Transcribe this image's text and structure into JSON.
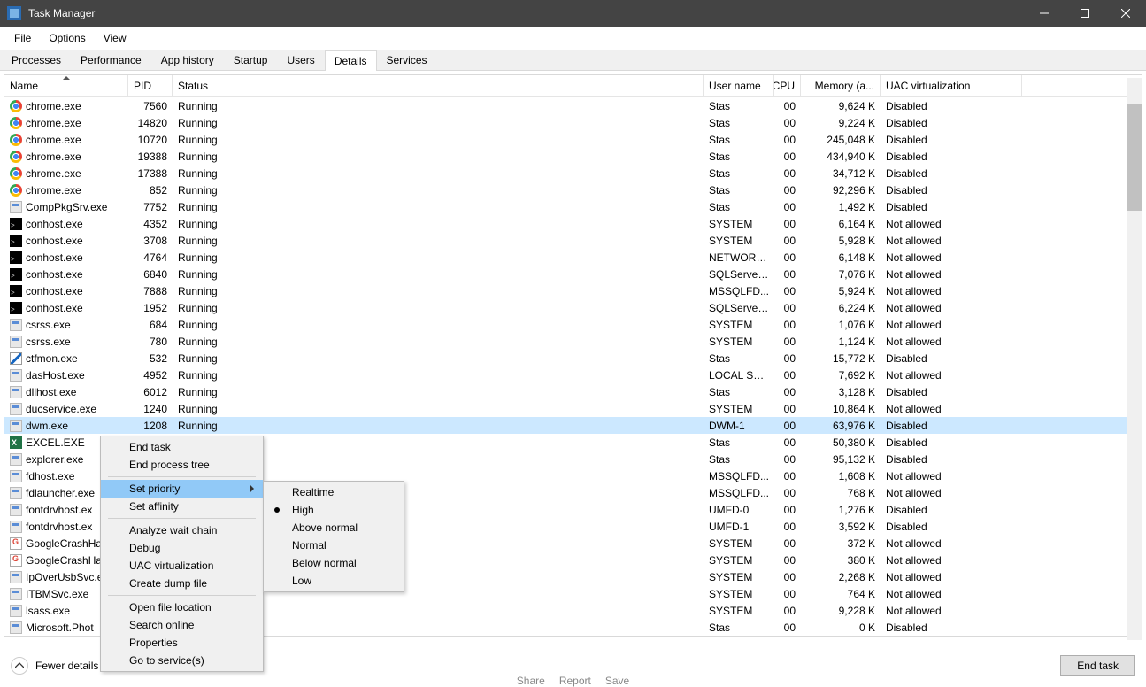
{
  "window": {
    "title": "Task Manager"
  },
  "menubar": [
    "File",
    "Options",
    "View"
  ],
  "tabs": [
    "Processes",
    "Performance",
    "App history",
    "Startup",
    "Users",
    "Details",
    "Services"
  ],
  "active_tab": 5,
  "columns": [
    "Name",
    "PID",
    "Status",
    "User name",
    "CPU",
    "Memory (a...",
    "UAC virtualization"
  ],
  "footer": {
    "fewer": "Fewer details",
    "end_task": "End task"
  },
  "sharebar": [
    "Share",
    "Report",
    "Save"
  ],
  "context_menu": {
    "items": [
      {
        "label": "End task"
      },
      {
        "label": "End process tree"
      },
      {
        "sep": true
      },
      {
        "label": "Set priority",
        "sub": true,
        "hover": true
      },
      {
        "label": "Set affinity"
      },
      {
        "sep": true
      },
      {
        "label": "Analyze wait chain"
      },
      {
        "label": "Debug"
      },
      {
        "label": "UAC virtualization"
      },
      {
        "label": "Create dump file"
      },
      {
        "sep": true
      },
      {
        "label": "Open file location"
      },
      {
        "label": "Search online"
      },
      {
        "label": "Properties"
      },
      {
        "label": "Go to service(s)"
      }
    ],
    "submenu": [
      {
        "label": "Realtime"
      },
      {
        "label": "High",
        "checked": true
      },
      {
        "label": "Above normal"
      },
      {
        "label": "Normal"
      },
      {
        "label": "Below normal"
      },
      {
        "label": "Low"
      }
    ]
  },
  "rows": [
    {
      "ic": "chrome",
      "name": "chrome.exe",
      "pid": "7560",
      "status": "Running",
      "user": "Stas",
      "cpu": "00",
      "mem": "9,624 K",
      "uac": "Disabled"
    },
    {
      "ic": "chrome",
      "name": "chrome.exe",
      "pid": "14820",
      "status": "Running",
      "user": "Stas",
      "cpu": "00",
      "mem": "9,224 K",
      "uac": "Disabled"
    },
    {
      "ic": "chrome",
      "name": "chrome.exe",
      "pid": "10720",
      "status": "Running",
      "user": "Stas",
      "cpu": "00",
      "mem": "245,048 K",
      "uac": "Disabled"
    },
    {
      "ic": "chrome",
      "name": "chrome.exe",
      "pid": "19388",
      "status": "Running",
      "user": "Stas",
      "cpu": "00",
      "mem": "434,940 K",
      "uac": "Disabled"
    },
    {
      "ic": "chrome",
      "name": "chrome.exe",
      "pid": "17388",
      "status": "Running",
      "user": "Stas",
      "cpu": "00",
      "mem": "34,712 K",
      "uac": "Disabled"
    },
    {
      "ic": "chrome",
      "name": "chrome.exe",
      "pid": "852",
      "status": "Running",
      "user": "Stas",
      "cpu": "00",
      "mem": "92,296 K",
      "uac": "Disabled"
    },
    {
      "ic": "gen",
      "name": "CompPkgSrv.exe",
      "pid": "7752",
      "status": "Running",
      "user": "Stas",
      "cpu": "00",
      "mem": "1,492 K",
      "uac": "Disabled"
    },
    {
      "ic": "cmd",
      "name": "conhost.exe",
      "pid": "4352",
      "status": "Running",
      "user": "SYSTEM",
      "cpu": "00",
      "mem": "6,164 K",
      "uac": "Not allowed"
    },
    {
      "ic": "cmd",
      "name": "conhost.exe",
      "pid": "3708",
      "status": "Running",
      "user": "SYSTEM",
      "cpu": "00",
      "mem": "5,928 K",
      "uac": "Not allowed"
    },
    {
      "ic": "cmd",
      "name": "conhost.exe",
      "pid": "4764",
      "status": "Running",
      "user": "NETWORK...",
      "cpu": "00",
      "mem": "6,148 K",
      "uac": "Not allowed"
    },
    {
      "ic": "cmd",
      "name": "conhost.exe",
      "pid": "6840",
      "status": "Running",
      "user": "SQLServer...",
      "cpu": "00",
      "mem": "7,076 K",
      "uac": "Not allowed"
    },
    {
      "ic": "cmd",
      "name": "conhost.exe",
      "pid": "7888",
      "status": "Running",
      "user": "MSSQLFD...",
      "cpu": "00",
      "mem": "5,924 K",
      "uac": "Not allowed"
    },
    {
      "ic": "cmd",
      "name": "conhost.exe",
      "pid": "1952",
      "status": "Running",
      "user": "SQLServer...",
      "cpu": "00",
      "mem": "6,224 K",
      "uac": "Not allowed"
    },
    {
      "ic": "gen",
      "name": "csrss.exe",
      "pid": "684",
      "status": "Running",
      "user": "SYSTEM",
      "cpu": "00",
      "mem": "1,076 K",
      "uac": "Not allowed"
    },
    {
      "ic": "gen",
      "name": "csrss.exe",
      "pid": "780",
      "status": "Running",
      "user": "SYSTEM",
      "cpu": "00",
      "mem": "1,124 K",
      "uac": "Not allowed"
    },
    {
      "ic": "pen",
      "name": "ctfmon.exe",
      "pid": "532",
      "status": "Running",
      "user": "Stas",
      "cpu": "00",
      "mem": "15,772 K",
      "uac": "Disabled"
    },
    {
      "ic": "gen",
      "name": "dasHost.exe",
      "pid": "4952",
      "status": "Running",
      "user": "LOCAL SE...",
      "cpu": "00",
      "mem": "7,692 K",
      "uac": "Not allowed"
    },
    {
      "ic": "gen",
      "name": "dllhost.exe",
      "pid": "6012",
      "status": "Running",
      "user": "Stas",
      "cpu": "00",
      "mem": "3,128 K",
      "uac": "Disabled"
    },
    {
      "ic": "gen",
      "name": "ducservice.exe",
      "pid": "1240",
      "status": "Running",
      "user": "SYSTEM",
      "cpu": "00",
      "mem": "10,864 K",
      "uac": "Not allowed"
    },
    {
      "ic": "gen",
      "name": "dwm.exe",
      "pid": "1208",
      "status": "Running",
      "user": "DWM-1",
      "cpu": "00",
      "mem": "63,976 K",
      "uac": "Disabled",
      "sel": true
    },
    {
      "ic": "excel",
      "name": "EXCEL.EXE",
      "pid": "",
      "status": "",
      "user": "Stas",
      "cpu": "00",
      "mem": "50,380 K",
      "uac": "Disabled"
    },
    {
      "ic": "gen",
      "name": "explorer.exe",
      "pid": "",
      "status": "",
      "user": "Stas",
      "cpu": "00",
      "mem": "95,132 K",
      "uac": "Disabled"
    },
    {
      "ic": "gen",
      "name": "fdhost.exe",
      "pid": "",
      "status": "",
      "user": "MSSQLFD...",
      "cpu": "00",
      "mem": "1,608 K",
      "uac": "Not allowed"
    },
    {
      "ic": "gen",
      "name": "fdlauncher.exe",
      "pid": "",
      "status": "",
      "user": "MSSQLFD...",
      "cpu": "00",
      "mem": "768 K",
      "uac": "Not allowed"
    },
    {
      "ic": "gen",
      "name": "fontdrvhost.ex",
      "pid": "",
      "status": "",
      "user": "UMFD-0",
      "cpu": "00",
      "mem": "1,276 K",
      "uac": "Disabled"
    },
    {
      "ic": "gen",
      "name": "fontdrvhost.ex",
      "pid": "",
      "status": "",
      "user": "UMFD-1",
      "cpu": "00",
      "mem": "3,592 K",
      "uac": "Disabled"
    },
    {
      "ic": "gc",
      "name": "GoogleCrashHa",
      "pid": "",
      "status": "",
      "user": "SYSTEM",
      "cpu": "00",
      "mem": "372 K",
      "uac": "Not allowed"
    },
    {
      "ic": "gc",
      "name": "GoogleCrashHa",
      "pid": "",
      "status": "",
      "user": "SYSTEM",
      "cpu": "00",
      "mem": "380 K",
      "uac": "Not allowed"
    },
    {
      "ic": "gen",
      "name": "IpOverUsbSvc.e",
      "pid": "",
      "status": "",
      "user": "SYSTEM",
      "cpu": "00",
      "mem": "2,268 K",
      "uac": "Not allowed"
    },
    {
      "ic": "gen",
      "name": "ITBMSvc.exe",
      "pid": "",
      "status": "",
      "user": "SYSTEM",
      "cpu": "00",
      "mem": "764 K",
      "uac": "Not allowed"
    },
    {
      "ic": "gen",
      "name": "lsass.exe",
      "pid": "",
      "status": "",
      "user": "SYSTEM",
      "cpu": "00",
      "mem": "9,228 K",
      "uac": "Not allowed"
    },
    {
      "ic": "gen",
      "name": "Microsoft.Phot",
      "pid": "",
      "status": "",
      "user": "Stas",
      "cpu": "00",
      "mem": "0 K",
      "uac": "Disabled"
    }
  ]
}
